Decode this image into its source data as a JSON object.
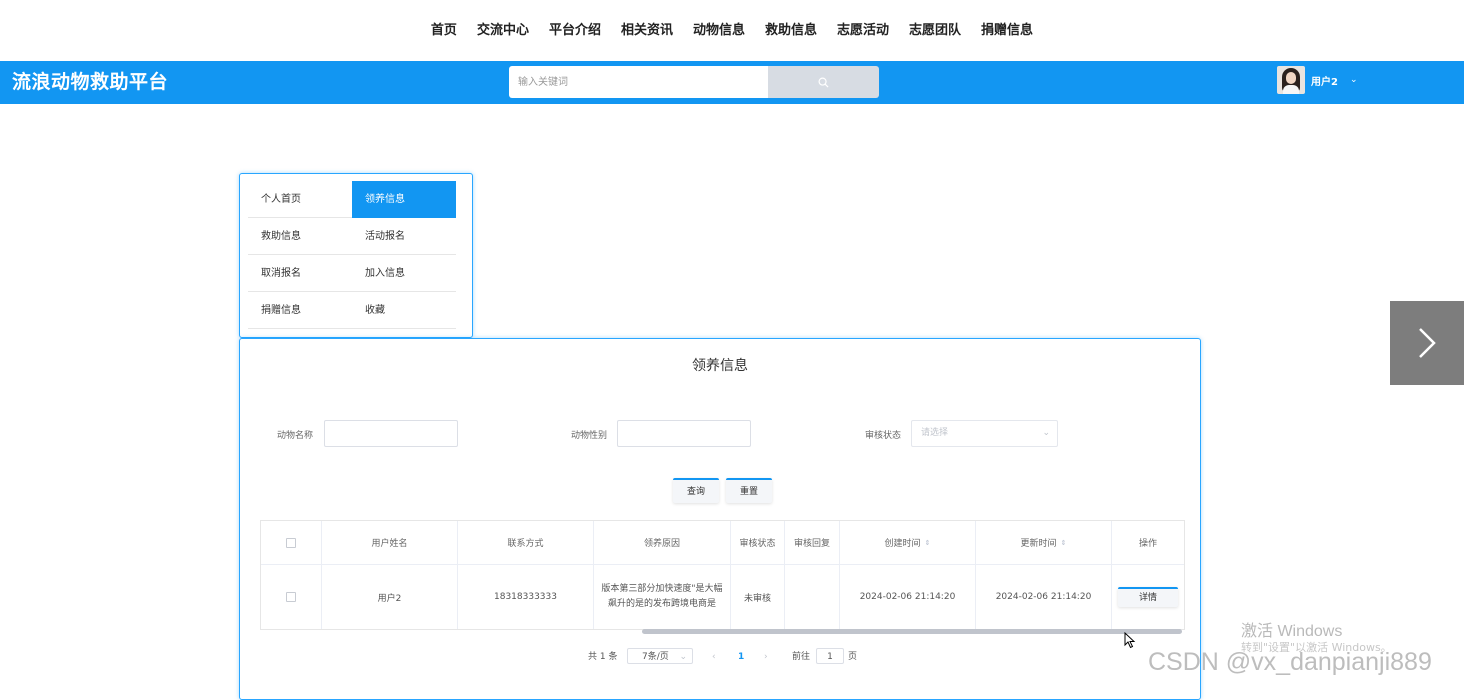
{
  "top_nav": [
    "首页",
    "交流中心",
    "平台介绍",
    "相关资讯",
    "动物信息",
    "救助信息",
    "志愿活动",
    "志愿团队",
    "捐赠信息"
  ],
  "header": {
    "brand": "流浪动物救助平台",
    "search_placeholder": "输入关键词",
    "user_name": "用户2"
  },
  "side_menu": {
    "items": [
      "个人首页",
      "领养信息",
      "救助信息",
      "活动报名",
      "取消报名",
      "加入信息",
      "捐赠信息",
      "收藏"
    ],
    "active": "领养信息"
  },
  "main": {
    "title": "领养信息",
    "filters": {
      "animal_name_label": "动物名称",
      "animal_gender_label": "动物性别",
      "review_status_label": "审核状态",
      "review_status_placeholder": "请选择"
    },
    "buttons": {
      "query": "查询",
      "reset": "重置"
    },
    "table": {
      "columns": [
        "用户姓名",
        "联系方式",
        "领养原因",
        "审核状态",
        "审核回复",
        "创建时间",
        "更新时间",
        "操作"
      ],
      "rows": [
        {
          "user_name": "用户2",
          "contact": "18318333333",
          "reason": "版本第三部分加快速度\"是大幅飙升的是的发布跨境电商是",
          "review_status": "未审核",
          "review_reply": "",
          "created": "2024-02-06 21:14:20",
          "updated": "2024-02-06 21:14:20",
          "action": "详情"
        }
      ]
    },
    "pagination": {
      "total_text": "共 1 条",
      "page_size": "7条/页",
      "current_page": "1",
      "goto_label": "前往",
      "goto_value": "1",
      "page_suffix": "页",
      "prev": "‹",
      "next": "›"
    }
  },
  "overlay": {
    "activate_windows": "激活 Windows",
    "activate_hint": "转到\"设置\"以激活 Windows。",
    "watermark": "CSDN @vx_danpianji889"
  },
  "colors": {
    "accent": "#1296f2"
  }
}
